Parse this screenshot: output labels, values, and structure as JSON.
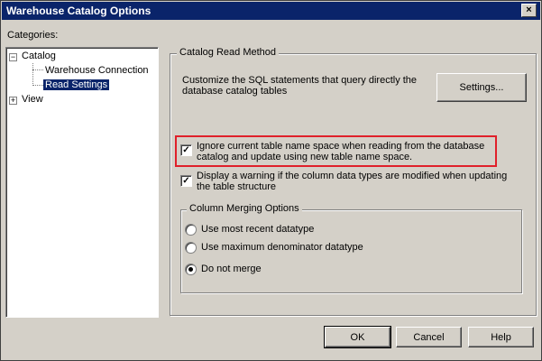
{
  "window": {
    "title": "Warehouse Catalog Options",
    "close_icon": "×"
  },
  "categories": {
    "label_pre": "",
    "label_u": "a",
    "label_full": "Categories:",
    "tree": {
      "catalog": "Catalog",
      "warehouse_connection": "Warehouse Connection",
      "read_settings": "Read Settings",
      "view": "View"
    }
  },
  "read_method": {
    "legend": "Catalog Read Method",
    "description_line1": "Customize the SQL statements that query directly the",
    "description_line2": "database catalog tables",
    "settings_button": "Settings..."
  },
  "options": {
    "ignore_namespace": {
      "line1": "Ignore current table name space when reading from the database",
      "line2": "catalog and update using new table name space.",
      "checked": true
    },
    "display_warning": {
      "line1": "Display a warning if the column data types are modified when updating",
      "line2": "the table structure",
      "checked": true
    }
  },
  "merging": {
    "legend": "Column Merging Options",
    "options": [
      {
        "label": "Use most recent datatype",
        "selected": false
      },
      {
        "label": "Use maximum denominator datatype",
        "selected": false
      },
      {
        "label": "Do not merge",
        "selected": true
      }
    ]
  },
  "footer": {
    "ok": "OK",
    "cancel": "Cancel",
    "help": "Help"
  },
  "colors": {
    "titlebar": "#0a246a",
    "highlight_box": "#e0202a",
    "dialog_bg": "#d4d0c8"
  }
}
